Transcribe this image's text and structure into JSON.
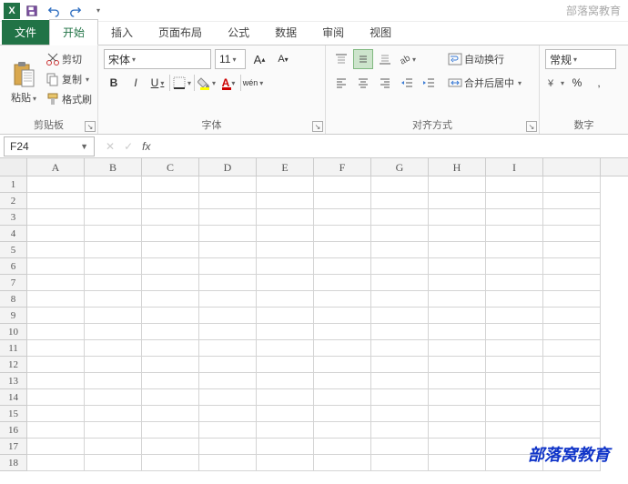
{
  "brand": "部落窝教育",
  "tabs": {
    "file": "文件",
    "home": "开始",
    "insert": "插入",
    "layout": "页面布局",
    "formula": "公式",
    "data": "数据",
    "review": "审阅",
    "view": "视图"
  },
  "clipboard": {
    "paste": "粘贴",
    "cut": "剪切",
    "copy": "复制",
    "painter": "格式刷",
    "group": "剪贴板"
  },
  "font": {
    "name": "宋体",
    "size": "11",
    "bold": "B",
    "italic": "I",
    "underline": "U",
    "wen": "wén",
    "group": "字体"
  },
  "align": {
    "wrap": "自动换行",
    "merge": "合并后居中",
    "group": "对齐方式"
  },
  "number": {
    "general": "常规",
    "percent": "%",
    "comma": ",",
    "group": "数字"
  },
  "namebox": "F24",
  "cols": [
    "A",
    "B",
    "C",
    "D",
    "E",
    "F",
    "G",
    "H",
    "I"
  ],
  "rows": [
    "1",
    "2",
    "3",
    "4",
    "5",
    "6",
    "7",
    "8",
    "9",
    "10",
    "11",
    "12",
    "13",
    "14",
    "15",
    "16",
    "17",
    "18"
  ],
  "watermark": "部落窝教育"
}
